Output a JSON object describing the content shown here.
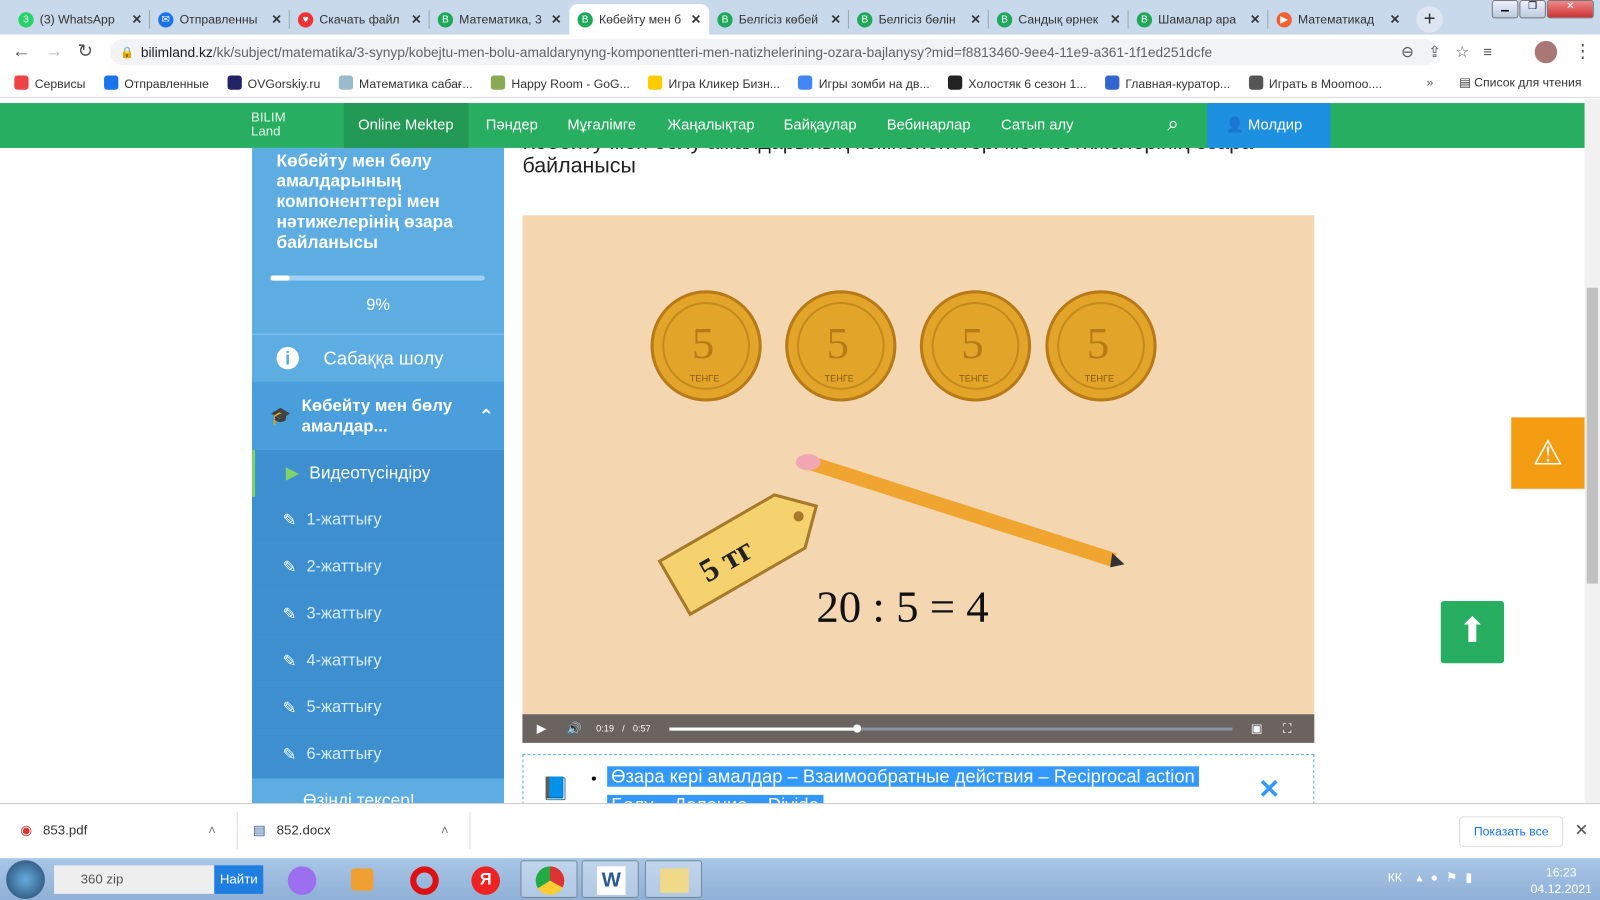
{
  "browser": {
    "tabs": [
      {
        "label": "(3) WhatsApp",
        "icon": "whatsapp-icon"
      },
      {
        "label": "Отправленны",
        "icon": "mail-icon"
      },
      {
        "label": "Скачать файл",
        "icon": "heart-icon"
      },
      {
        "label": "Математика, 3",
        "icon": "bilimland-icon"
      },
      {
        "label": "Көбейту мен б",
        "icon": "bilimland-icon",
        "active": true
      },
      {
        "label": "Белгісіз көбей",
        "icon": "bilimland-icon"
      },
      {
        "label": "Белгісіз бөлін",
        "icon": "bilimland-icon"
      },
      {
        "label": "Сандық өрнек",
        "icon": "bilimland-icon"
      },
      {
        "label": "Шамалар ара",
        "icon": "bilimland-icon"
      },
      {
        "label": "Математикад",
        "icon": "play-icon"
      }
    ],
    "url_host": "bilimland.kz",
    "url_path": "/kk/subject/matematika/3-synyp/kobejtu-men-bolu-amaldarynyng-komponentteri-men-natizhelerining-ozara-bajlanysy?mid=f8813460-9ee4-11e9-a361-1f1ed251dcfe",
    "bookmarks": [
      "Сервисы",
      "Отправленные",
      "OVGorskiy.ru",
      "Математика сабағ...",
      "Happy Room - GoG...",
      "Игра Кликер Бизн...",
      "Игры зомби на дв...",
      "Холостяк 6 сезон 1...",
      "Главная-куратор...",
      "Играть в Moomoo...."
    ],
    "bookmarks_more": "»",
    "reading_list": "Список для чтения"
  },
  "site": {
    "logo": "BILIM Land",
    "nav": [
      "Online Mektep",
      "Пәндер",
      "Мұғалімге",
      "Жаңалықтар",
      "Байқаулар",
      "Вебинарлар",
      "Сатып алу"
    ],
    "user": "Молдир",
    "accent": "#27ae60"
  },
  "sidebar": {
    "title": "Көбейту мен бөлу амалдарының компоненттері мен нәтижелерінің өзара байланысы",
    "progress": 9,
    "progress_label": "9%",
    "overview": "Сабаққа шолу",
    "section": "Көбейту мен бөлу амалдар...",
    "items": [
      "Видеотүсіндіру",
      "1-жаттығу",
      "2-жаттығу",
      "3-жаттығу",
      "4-жаттығу",
      "5-жаттығу",
      "6-жаттығу"
    ],
    "next_section": "Өзіңді тексер!"
  },
  "main": {
    "title": "Көбейту мен бөлу амалдарының компоненттері мен нәтижелерінің өзара байланысы",
    "video": {
      "current": "0:19",
      "sep": "/",
      "duration": "0:57",
      "progress": 0.333,
      "tag": "5 тг",
      "equation": "20 : 5 = 4",
      "coin_text": "ТЕНГЕ",
      "coin_value": "5"
    },
    "glossary": [
      "Өзара кері амалдар – Взаимообратные действия – Reciprocal action",
      "Бөлу – Деление – Divide"
    ]
  },
  "downloads": {
    "files": [
      "853.pdf",
      "852.docx"
    ],
    "show_all": "Показать все"
  },
  "taskbar": {
    "search_value": "360 zip",
    "search_button": "Найти",
    "lang": "КК",
    "time": "16:23",
    "date": "04.12.2021"
  }
}
